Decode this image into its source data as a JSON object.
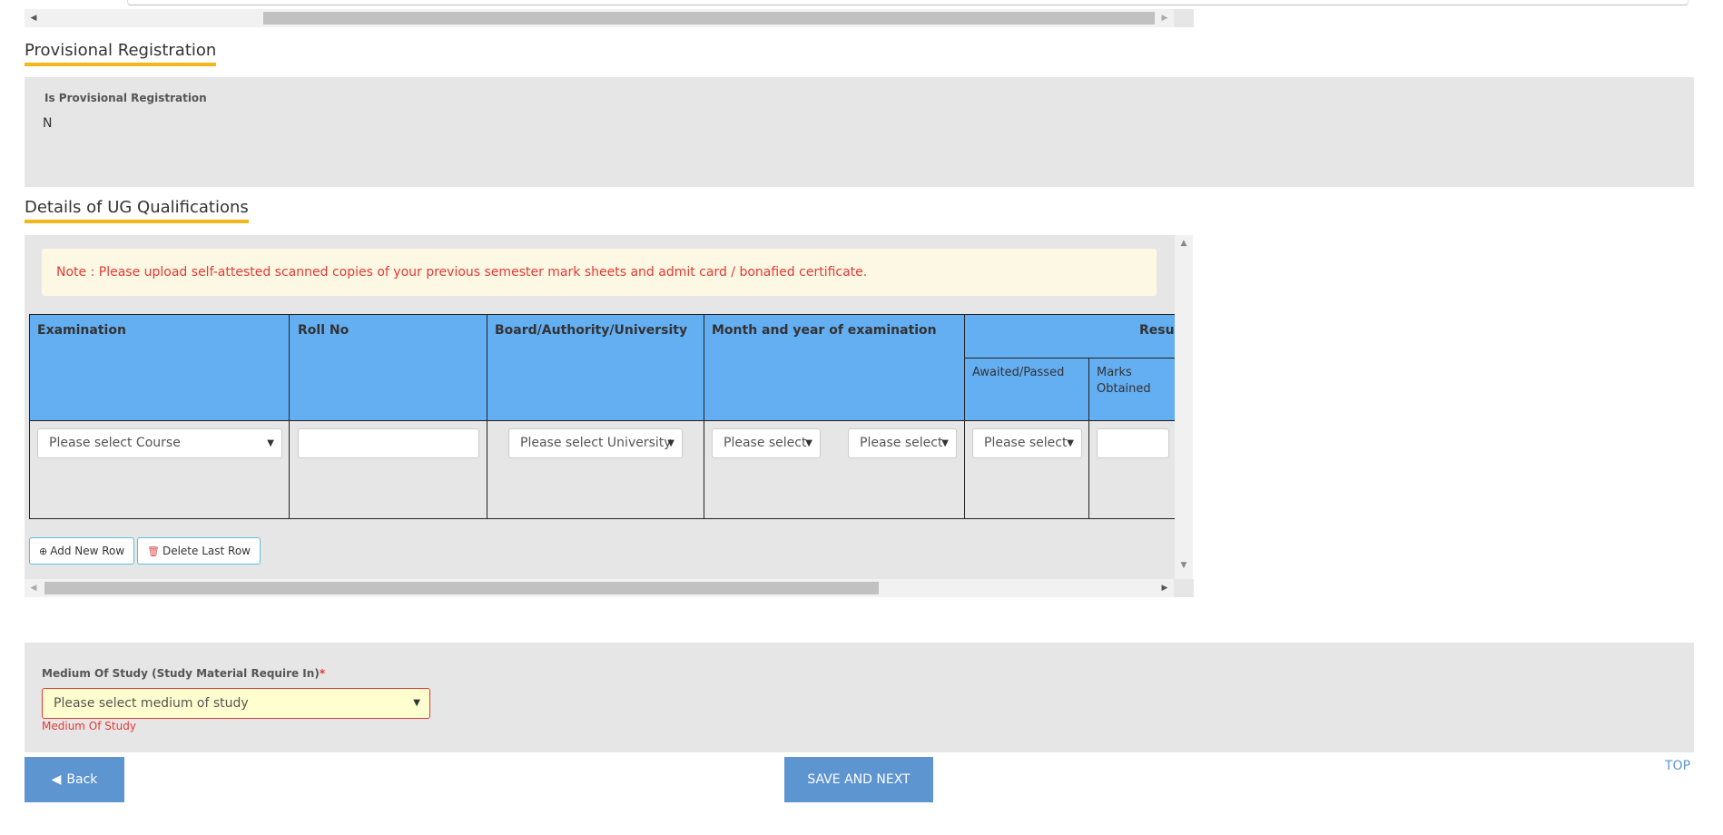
{
  "provisional": {
    "title": "Provisional Registration",
    "label": "Is Provisional Registration",
    "value": "N"
  },
  "ug": {
    "title": "Details of UG Qualifications",
    "note": "Note : Please upload self-attested scanned copies of your previous semester mark sheets and admit card / bonafied certificate.",
    "columns": {
      "examination": "Examination",
      "roll_no": "Roll No",
      "board": "Board/Authority/University",
      "month_year": "Month and year of examination",
      "result": "Result",
      "awaited_passed": "Awaited/Passed",
      "marks_obtained": "Marks Obtained"
    },
    "row": {
      "course_placeholder": "Please select Course",
      "university_placeholder": "Please select University",
      "month_placeholder": "Please select",
      "year_placeholder": "Please select",
      "awaited_placeholder": "Please select"
    },
    "add_row_label": "Add New Row",
    "delete_row_label": "Delete Last Row"
  },
  "medium": {
    "label": "Medium Of Study (Study Material Require In)",
    "required_mark": "*",
    "placeholder": "Please select medium of study",
    "error": "Medium Of Study"
  },
  "footer": {
    "back_label": "Back",
    "save_label": "SAVE AND NEXT",
    "top_label": "TOP"
  },
  "colors": {
    "accent_underline": "#f3b61b",
    "table_header": "#64aef2",
    "primary_button": "#5d95d1",
    "error": "#e53935"
  }
}
